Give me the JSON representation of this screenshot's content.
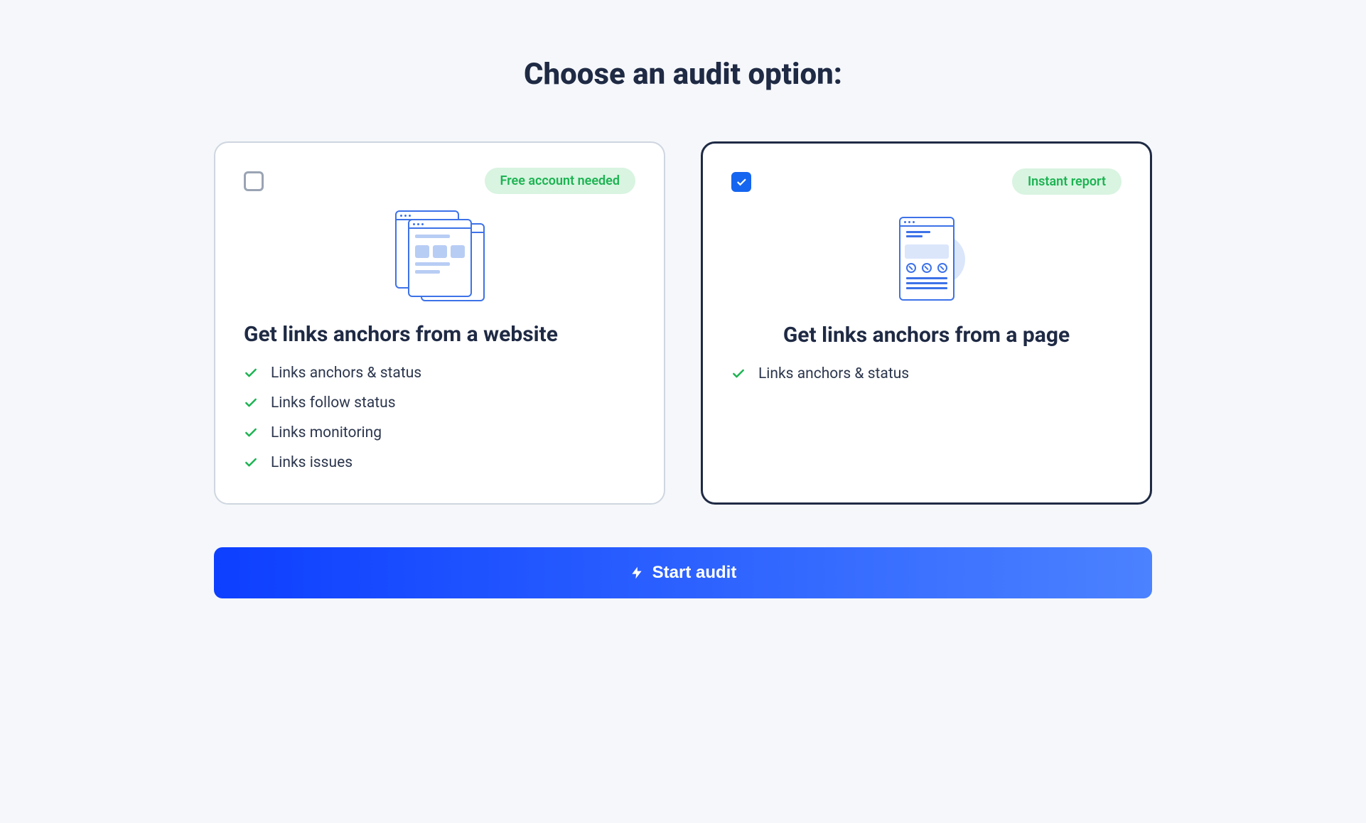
{
  "heading": "Choose an audit option:",
  "cards": [
    {
      "selected": false,
      "badge": "Free account needed",
      "title": "Get links anchors from a website",
      "features": [
        "Links anchors & status",
        "Links follow status",
        "Links monitoring",
        "Links issues"
      ]
    },
    {
      "selected": true,
      "badge": "Instant report",
      "title": "Get links anchors from a page",
      "features": [
        "Links anchors & status"
      ]
    }
  ],
  "start_button": "Start audit"
}
